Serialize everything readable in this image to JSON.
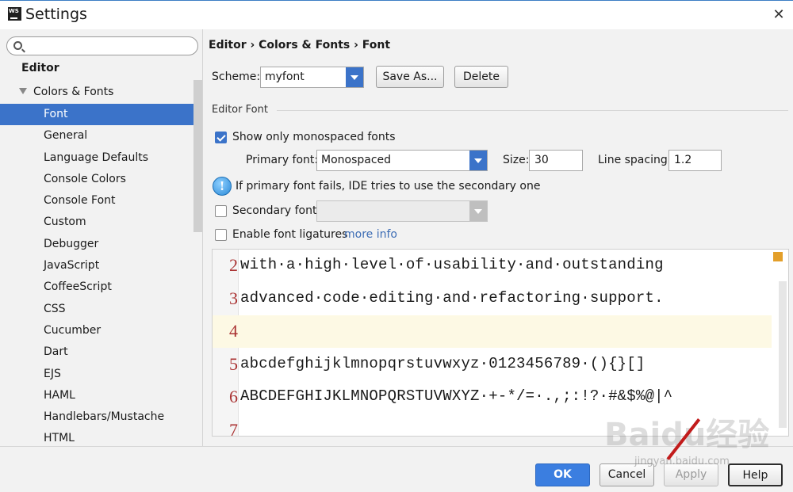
{
  "window": {
    "title": "Settings",
    "icon_label": "WS"
  },
  "search": {
    "placeholder": ""
  },
  "sidebar": {
    "root": "Editor",
    "group": "Colors & Fonts",
    "items": [
      "Font",
      "General",
      "Language Defaults",
      "Console Colors",
      "Console Font",
      "Custom",
      "Debugger",
      "JavaScript",
      "CoffeeScript",
      "CSS",
      "Cucumber",
      "Dart",
      "EJS",
      "HAML",
      "Handlebars/Mustache",
      "HTML"
    ],
    "selected_index": 0
  },
  "breadcrumb": "Editor › Colors & Fonts › Font",
  "scheme": {
    "label": "Scheme:",
    "value": "myfont",
    "save_as": "Save As...",
    "delete": "Delete"
  },
  "editor_font": {
    "section_title": "Editor Font",
    "monospaced_only": {
      "label": "Show only monospaced fonts",
      "checked": true
    },
    "primary_font": {
      "label": "Primary font:",
      "value": "Monospaced"
    },
    "size": {
      "label": "Size:",
      "value": "30"
    },
    "line_spacing": {
      "label": "Line spacing:",
      "value": "1.2"
    },
    "info": "If primary font fails, IDE tries to use the secondary one",
    "secondary_font": {
      "label": "Secondary font:",
      "value": "",
      "checked": false
    },
    "ligatures": {
      "label": "Enable font ligatures",
      "checked": false,
      "more_info": "more info"
    }
  },
  "preview": {
    "lines": [
      {
        "num": "2",
        "text": "with·a·high·level·of·usability·and·outstanding"
      },
      {
        "num": "3",
        "text": "advanced·code·editing·and·refactoring·support."
      },
      {
        "num": "4",
        "text": ""
      },
      {
        "num": "5",
        "text": "abcdefghijklmnopqrstuvwxyz·0123456789·(){}[]"
      },
      {
        "num": "6",
        "text": "ABCDEFGHIJKLMNOPQRSTUVWXYZ·+-*/=·.,;:!?·#&$%@|^"
      },
      {
        "num": "7",
        "text": ""
      }
    ],
    "current_line_index": 2
  },
  "footer": {
    "ok": "OK",
    "cancel": "Cancel",
    "apply": "Apply",
    "help": "Help"
  },
  "watermark": {
    "main": "Baidu经验",
    "sub": "jingyan.baidu.com"
  },
  "colors": {
    "accent": "#3b73c9",
    "current_line": "#fdf9e4",
    "line_number": "#a33333"
  }
}
